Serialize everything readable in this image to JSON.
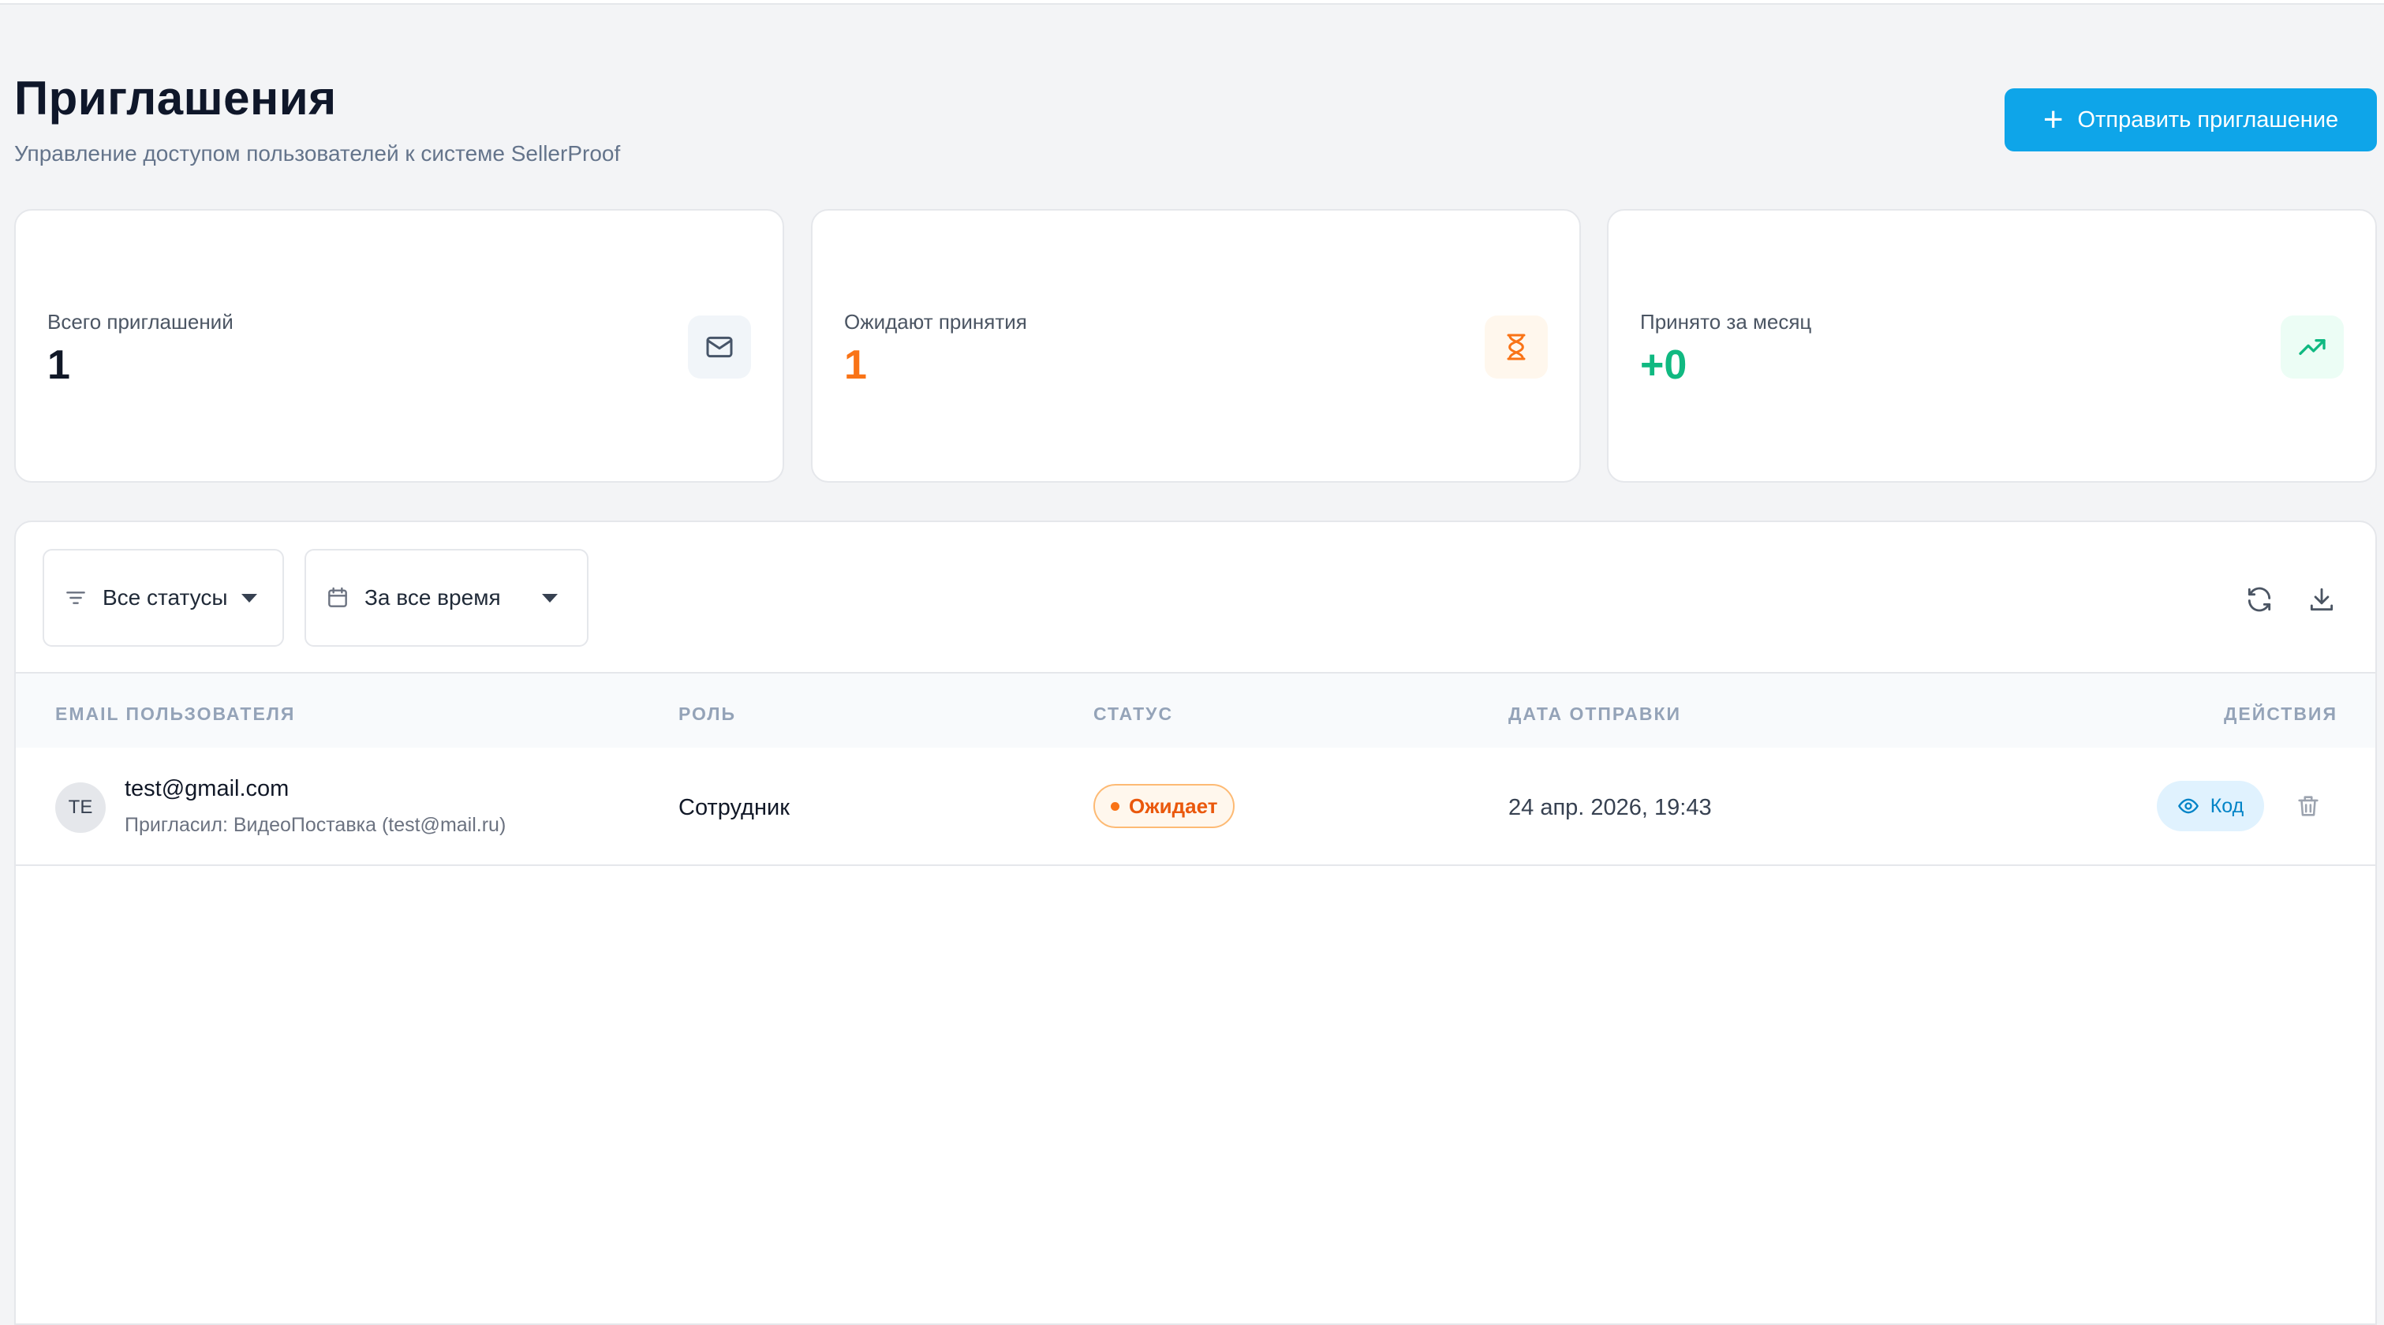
{
  "header": {
    "title": "Приглашения",
    "subtitle": "Управление доступом пользователей к системе SellerProof",
    "send_button": "Отправить приглашение"
  },
  "stats": [
    {
      "label": "Всего приглашений",
      "value": "1",
      "icon": "mail-icon",
      "color": "#111827",
      "icon_bg": "#f1f5f9",
      "icon_color": "#475569"
    },
    {
      "label": "Ожидают принятия",
      "value": "1",
      "icon": "hourglass-icon",
      "color": "#f97316",
      "icon_bg": "#fff7ed",
      "icon_color": "#f97316"
    },
    {
      "label": "Принято за месяц",
      "value": "+0",
      "icon": "trending-up-icon",
      "color": "#10b981",
      "icon_bg": "#ecfdf5",
      "icon_color": "#10b981"
    }
  ],
  "filters": {
    "status": "Все статусы",
    "period": "За все время"
  },
  "table": {
    "columns": {
      "email": "Email пользователя",
      "role": "Роль",
      "status": "Статус",
      "date": "Дата отправки",
      "actions": "Действия"
    },
    "rows": [
      {
        "initials": "TE",
        "email": "test@gmail.com",
        "invited_by": "Пригласил: ВидеоПоставка (test@mail.ru)",
        "role": "Сотрудник",
        "status": "Ожидает",
        "date": "24 апр. 2026, 19:43",
        "code_label": "Код"
      }
    ]
  },
  "colors": {
    "accent": "#0ea5e9",
    "pending": "#f97316",
    "success": "#10b981"
  }
}
